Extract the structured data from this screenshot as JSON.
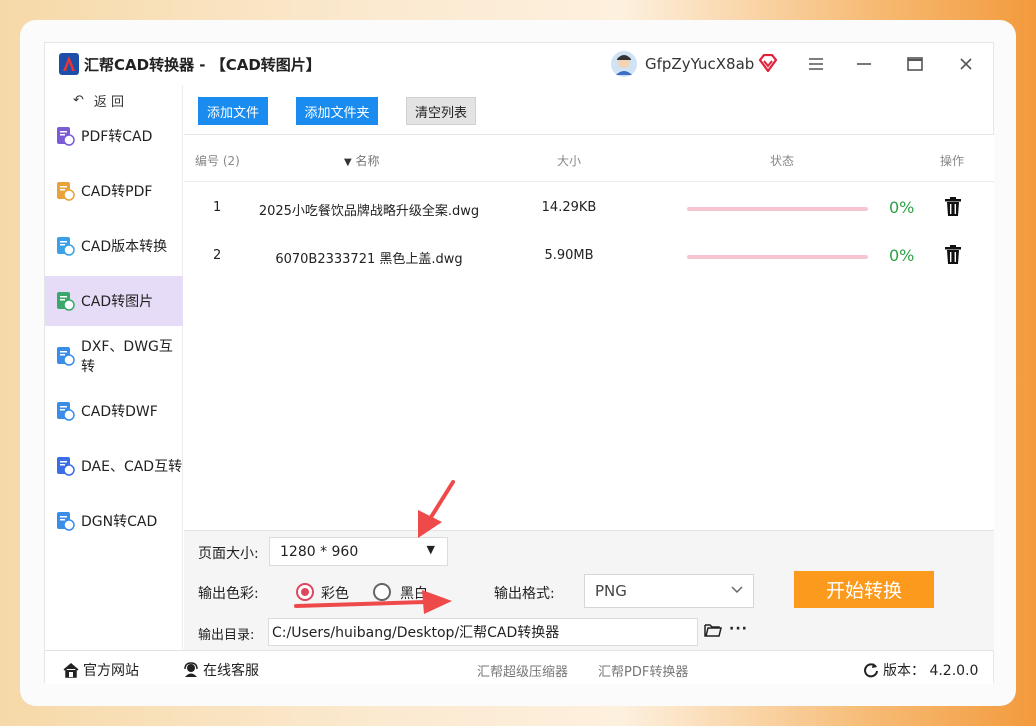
{
  "window": {
    "title": "汇帮CAD转换器 - 【CAD转图片】",
    "username": "GfpZyYucX8ab"
  },
  "sidebar": {
    "back_label": "返 回",
    "items": [
      {
        "label": "PDF转CAD",
        "color": "#7b5cd6"
      },
      {
        "label": "CAD转PDF",
        "color": "#e8a33a"
      },
      {
        "label": "CAD版本转换",
        "color": "#3aa0e8"
      },
      {
        "label": "CAD转图片",
        "color": "#3aa86b"
      },
      {
        "label": "DXF、DWG互转",
        "color": "#3a8de8"
      },
      {
        "label": "CAD转DWF",
        "color": "#3a8de8"
      },
      {
        "label": "DAE、CAD互转",
        "color": "#3a6de8"
      },
      {
        "label": "DGN转CAD",
        "color": "#3a8de8"
      }
    ]
  },
  "toolbar": {
    "add_file": "添加文件",
    "add_folder": "添加文件夹",
    "clear_list": "清空列表"
  },
  "table": {
    "headers": {
      "index": "编号 (2)",
      "name": "名称",
      "size": "大小",
      "status": "状态",
      "action": "操作"
    },
    "rows": [
      {
        "index": "1",
        "name": "2025小吃餐饮品牌战略升级全案.dwg",
        "size": "14.29KB",
        "progress": 0,
        "percent": "0%"
      },
      {
        "index": "2",
        "name": "6070B2333721 黑色上盖.dwg",
        "size": "5.90MB",
        "progress": 0,
        "percent": "0%"
      }
    ]
  },
  "options": {
    "page_size_label": "页面大小:",
    "page_size_value": "1280 * 960",
    "color_label": "输出色彩:",
    "color_option_color": "彩色",
    "color_option_bw": "黑白",
    "color_selected": "彩色",
    "format_label": "输出格式:",
    "format_value": "PNG",
    "start_button": "开始转换",
    "output_dir_label": "输出目录:",
    "output_dir_value": "C:/Users/huibang/Desktop/汇帮CAD转换器",
    "more": "···"
  },
  "statusbar": {
    "website": "官方网站",
    "support": "在线客服",
    "link1": "汇帮超级压缩器",
    "link2": "汇帮PDF转换器",
    "version": "版本： 4.2.0.0"
  },
  "colors": {
    "accent_blue": "#1a8cf0",
    "start_orange": "#fb9a1c",
    "active_nav": "#e7dcf7",
    "progress_pink": "#f6c5d2",
    "percent_green": "#2ea043",
    "arrow_red": "#ef4a4a"
  }
}
